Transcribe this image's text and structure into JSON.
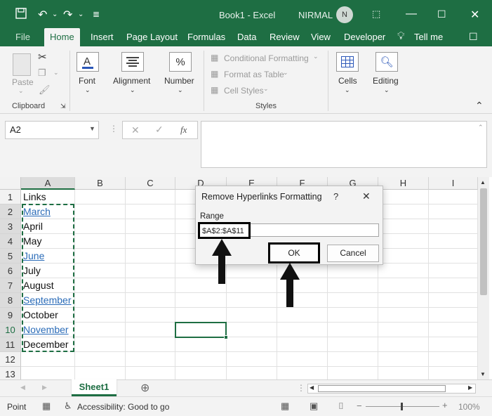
{
  "app": {
    "title": "Book1  -  Excel",
    "user": "NIRMAL",
    "avatar_initial": "N",
    "accent": "#1e6e43"
  },
  "tabs": [
    "File",
    "Home",
    "Insert",
    "Page Layout",
    "Formulas",
    "Data",
    "Review",
    "View",
    "Developer",
    "Tell me"
  ],
  "ribbon": {
    "paste": "Paste",
    "clipboard": "Clipboard",
    "font": "Font",
    "alignment": "Alignment",
    "number": "Number",
    "number_icon": "%",
    "cond_format": "Conditional Formatting",
    "format_table": "Format as Table",
    "cell_styles": "Cell Styles",
    "styles": "Styles",
    "cells": "Cells",
    "editing": "Editing"
  },
  "formula_bar": {
    "name_box": "A2",
    "fx": "fx"
  },
  "columns": [
    "A",
    "B",
    "C",
    "D",
    "E",
    "F",
    "G",
    "H",
    "I"
  ],
  "rows": [
    "1",
    "2",
    "3",
    "4",
    "5",
    "6",
    "7",
    "8",
    "9",
    "10",
    "11",
    "12",
    "13"
  ],
  "cells": [
    {
      "text": "Links",
      "link": false
    },
    {
      "text": "March",
      "link": true
    },
    {
      "text": "April",
      "link": false
    },
    {
      "text": "May",
      "link": false
    },
    {
      "text": "June",
      "link": true
    },
    {
      "text": "July",
      "link": false
    },
    {
      "text": "August",
      "link": false
    },
    {
      "text": "September",
      "link": true
    },
    {
      "text": "October",
      "link": false
    },
    {
      "text": "November",
      "link": true
    },
    {
      "text": "December",
      "link": false
    }
  ],
  "sheet": {
    "tab": "Sheet1"
  },
  "status": {
    "mode": "Point",
    "accessibility": "Accessibility: Good to go",
    "zoom": "100%"
  },
  "dialog": {
    "title": "Remove Hyperlinks Formatting",
    "help": "?",
    "range_label": "Range",
    "range_value": "$A$2:$A$11",
    "ok": "OK",
    "cancel": "Cancel"
  }
}
